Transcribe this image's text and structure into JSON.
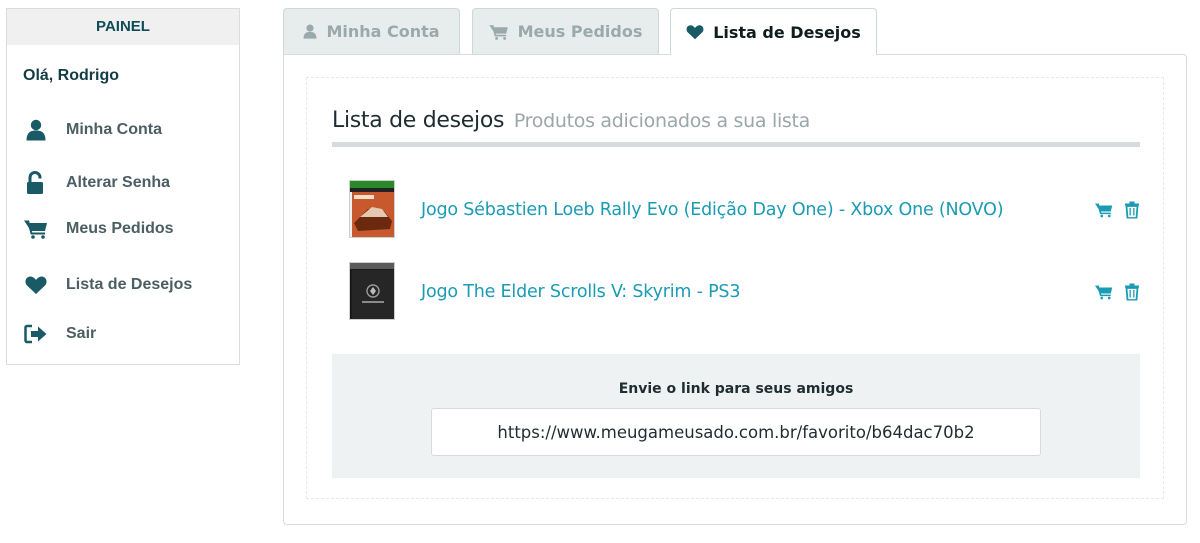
{
  "sidebar": {
    "title": "PAINEL",
    "greeting": "Olá, Rodrigo",
    "items": [
      {
        "label": "Minha Conta",
        "icon": "user-icon"
      },
      {
        "label": "Alterar Senha",
        "icon": "unlock-icon"
      },
      {
        "label": "Meus Pedidos",
        "icon": "cart-icon"
      },
      {
        "label": "Lista de Desejos",
        "icon": "heart-icon"
      },
      {
        "label": "Sair",
        "icon": "sign-out-icon"
      }
    ]
  },
  "tabs": [
    {
      "label": "Minha Conta",
      "icon": "user-icon",
      "active": false
    },
    {
      "label": "Meus Pedidos",
      "icon": "cart-icon",
      "active": false
    },
    {
      "label": "Lista de Desejos",
      "icon": "heart-icon",
      "active": true
    }
  ],
  "wishlist": {
    "title": "Lista de desejos",
    "subtitle": "Produtos adicionados a sua lista",
    "items": [
      {
        "name": "Jogo Sébastien Loeb Rally Evo (Edição Day One) - Xbox One (NOVO)"
      },
      {
        "name": "Jogo The Elder Scrolls V: Skyrim - PS3"
      }
    ],
    "share": {
      "label": "Envie o link para seus amigos",
      "link": "https://www.meugameusado.com.br/favorito/b64dac70b2"
    }
  },
  "colors": {
    "accent": "#1b9bb4",
    "header_text": "#0f4c57",
    "icon_dark": "#195a66"
  }
}
